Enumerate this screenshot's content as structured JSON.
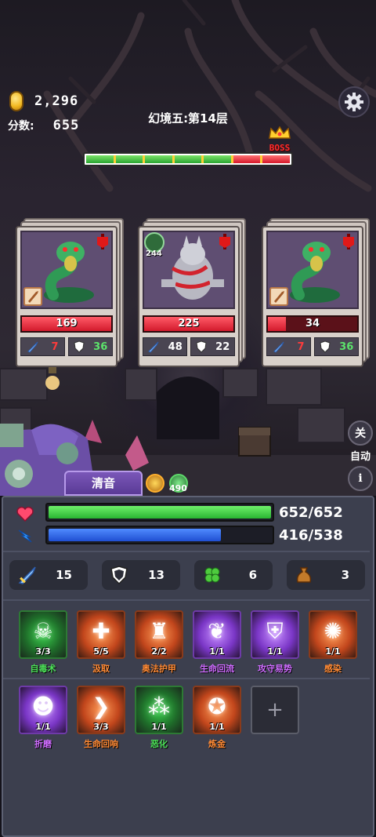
{
  "hud": {
    "gold": "2,296",
    "score_label": "分数:",
    "score": "655",
    "stage": "幻境五:第14层",
    "boss_label": "BOSS",
    "progress_segments": 7,
    "progress_done_segments": 5,
    "boss_segment_index": 6
  },
  "enemies": [
    {
      "name": "snake",
      "hp": "169",
      "hp_fraction": 1.0,
      "attack": "7",
      "defense": "36",
      "defense_color": "green",
      "weapon": true,
      "poison": ""
    },
    {
      "name": "werewolf",
      "hp": "225",
      "hp_fraction": 1.0,
      "attack": "48",
      "defense": "22",
      "defense_color": "white",
      "weapon": false,
      "poison": "244"
    },
    {
      "name": "snake",
      "hp": "34",
      "hp_fraction": 0.2,
      "attack": "7",
      "defense": "36",
      "defense_color": "green",
      "weapon": true,
      "poison": ""
    }
  ],
  "side": {
    "close_label": "关",
    "auto_label": "自动",
    "info_label": "i"
  },
  "hero": {
    "name": "清音",
    "buff_value": "490"
  },
  "stats": {
    "hp_text": "652/652",
    "hp_fraction": 1.0,
    "mp_text": "416/538",
    "mp_fraction": 0.773,
    "attack": "15",
    "defense": "13",
    "luck": "6",
    "bag": "3"
  },
  "skills_row1": [
    {
      "name": "自毒术",
      "count": "3/3",
      "color": "green",
      "icon": "skull-icon"
    },
    {
      "name": "汲取",
      "count": "5/5",
      "color": "orange",
      "icon": "cross-icon"
    },
    {
      "name": "奥法护甲",
      "count": "2/2",
      "color": "orange",
      "icon": "guardian-icon"
    },
    {
      "name": "生命回流",
      "count": "1/1",
      "color": "purple",
      "icon": "spirit-icon"
    },
    {
      "name": "攻守易势",
      "count": "1/1",
      "color": "purple",
      "icon": "shield-swap-icon"
    },
    {
      "name": "感染",
      "count": "1/1",
      "color": "orange",
      "icon": "splash-icon"
    }
  ],
  "skills_row2": [
    {
      "name": "折磨",
      "count": "1/1",
      "color": "purple",
      "icon": "demon-icon"
    },
    {
      "name": "生命回响",
      "count": "3/3",
      "color": "orange",
      "icon": "flex-icon"
    },
    {
      "name": "恶化",
      "count": "1/1",
      "color": "green",
      "icon": "drip-icon"
    },
    {
      "name": "炼金",
      "count": "1/1",
      "color": "orange",
      "icon": "alchemy-icon"
    }
  ],
  "add_skill_label": "+"
}
